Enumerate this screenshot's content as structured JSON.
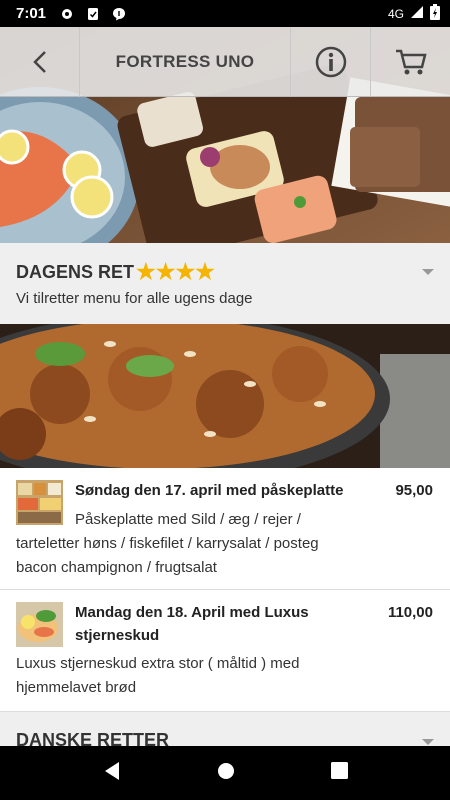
{
  "status_bar": {
    "time": "7:01",
    "network": "4G"
  },
  "header": {
    "title": "FORTRESS UNO",
    "back_icon": "back-arrow-icon",
    "info_icon": "info-icon",
    "cart_icon": "cart-icon"
  },
  "sections": [
    {
      "title": "DAGENS RET",
      "stars": "★★★★",
      "subtitle": "Vi tilretter menu for alle ugens dage"
    },
    {
      "title": "DANSKE RETTER"
    }
  ],
  "items": [
    {
      "name": "Søndag den 17. april med påskeplatte",
      "price": "95,00",
      "desc_line1": "Påskeplatte med Sild / æg / rejer /",
      "desc_line2": "tarteletter høns / fiskefilet / karrysalat / posteg",
      "desc_line3": "bacon champignon / frugtsalat"
    },
    {
      "name_line1": "Mandag den 18. April med Luxus",
      "name_line2": "stjerneskud",
      "price": "110,00",
      "desc_line1": "Luxus stjerneskud extra stor ( måltid ) med",
      "desc_line2": "hjemmelavet brød"
    }
  ],
  "colors": {
    "star": "#f4b400",
    "section_bg": "#efefef",
    "header_bg": "#ebebeb"
  }
}
